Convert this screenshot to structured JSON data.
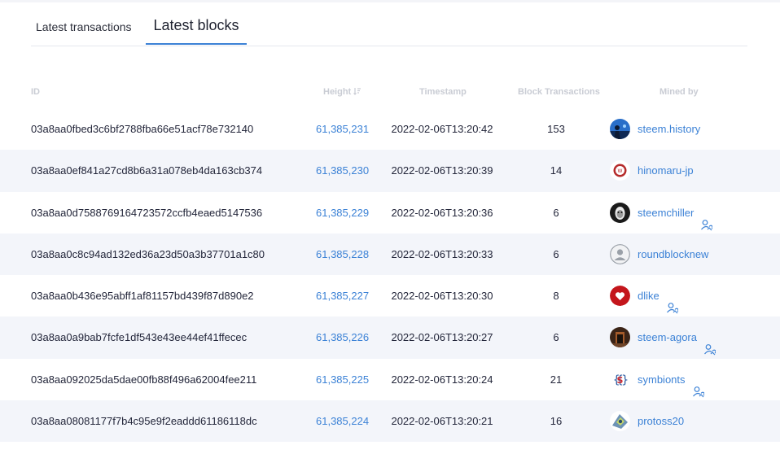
{
  "tabs": {
    "transactions_label": "Latest transactions",
    "blocks_label": "Latest blocks"
  },
  "table": {
    "headers": {
      "id": "ID",
      "height": "Height",
      "timestamp": "Timestamp",
      "block_transactions": "Block Transactions",
      "mined_by": "Mined by"
    },
    "rows": [
      {
        "id": "03a8aa0fbed3c6bf2788fba66e51acf78e732140",
        "height": "61,385,231",
        "timestamp": "2022-02-06T13:20:42",
        "block_transactions": "153",
        "miner": "steem.history",
        "avatar_icon": "steem-history-avatar-icon",
        "proxy": false
      },
      {
        "id": "03a8aa0ef841a27cd8b6a31a078eb4da163cb374",
        "height": "61,385,230",
        "timestamp": "2022-02-06T13:20:39",
        "block_transactions": "14",
        "miner": "hinomaru-jp",
        "avatar_icon": "hinomaru-jp-avatar-icon",
        "proxy": false
      },
      {
        "id": "03a8aa0d7588769164723572ccfb4eaed5147536",
        "height": "61,385,229",
        "timestamp": "2022-02-06T13:20:36",
        "block_transactions": "6",
        "miner": "steemchiller",
        "avatar_icon": "steemchiller-avatar-icon",
        "proxy": true
      },
      {
        "id": "03a8aa0c8c94ad132ed36a23d50a3b37701a1c80",
        "height": "61,385,228",
        "timestamp": "2022-02-06T13:20:33",
        "block_transactions": "6",
        "miner": "roundblocknew",
        "avatar_icon": "default-user-avatar-icon",
        "proxy": false
      },
      {
        "id": "03a8aa0b436e95abff1af81157bd439f87d890e2",
        "height": "61,385,227",
        "timestamp": "2022-02-06T13:20:30",
        "block_transactions": "8",
        "miner": "dlike",
        "avatar_icon": "dlike-heart-avatar-icon",
        "proxy": true
      },
      {
        "id": "03a8aa0a9bab7fcfe1df543e43ee44ef41ffecec",
        "height": "61,385,226",
        "timestamp": "2022-02-06T13:20:27",
        "block_transactions": "6",
        "miner": "steem-agora",
        "avatar_icon": "steem-agora-avatar-icon",
        "proxy": true
      },
      {
        "id": "03a8aa092025da5dae00fb88f496a62004fee211",
        "height": "61,385,225",
        "timestamp": "2022-02-06T13:20:24",
        "block_transactions": "21",
        "miner": "symbionts",
        "avatar_icon": "symbionts-avatar-icon",
        "proxy": true
      },
      {
        "id": "03a8aa08081177f7b4c95e9f2eaddd61186118dc",
        "height": "61,385,224",
        "timestamp": "2022-02-06T13:20:21",
        "block_transactions": "16",
        "miner": "protoss20",
        "avatar_icon": "protoss20-avatar-icon",
        "proxy": false
      }
    ]
  },
  "colors": {
    "accent": "#3c82d6",
    "row_alt": "#f3f5fa",
    "header_text": "#c9ccd4"
  }
}
